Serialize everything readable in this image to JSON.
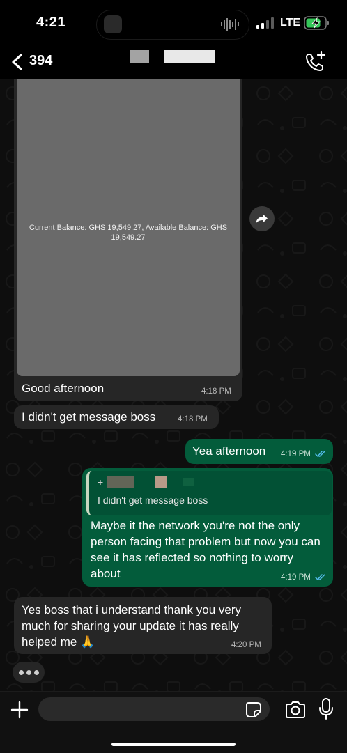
{
  "status_bar": {
    "time": "4:21",
    "network": "LTE"
  },
  "header": {
    "back_count": "394",
    "icons": {
      "back": "chevron-left-icon",
      "call": "add-call-icon"
    }
  },
  "messages": [
    {
      "direction": "incoming",
      "image_caption": "Current Balance: GHS 19,549.27, Available Balance: GHS 19,549.27",
      "text": "Good afternoon",
      "time": "4:18 PM"
    },
    {
      "direction": "incoming",
      "text": "I didn't get message boss",
      "time": "4:18 PM"
    },
    {
      "direction": "outgoing",
      "text": "Yea afternoon",
      "time": "4:19 PM"
    },
    {
      "direction": "outgoing",
      "reply_to": {
        "sender": "+",
        "text": "I didn't get message boss"
      },
      "text": "Maybe it the network you're not the only person facing that problem but now you can see it has reflected so nothing to worry about",
      "time": "4:19 PM"
    },
    {
      "direction": "incoming",
      "text": "Yes boss that i understand thank you very much for sharing your update it has really helped me 🙏",
      "time": "4:20 PM"
    }
  ],
  "composer": {
    "input_value": "",
    "icons": [
      "plus-icon",
      "sticker-icon",
      "camera-icon",
      "mic-icon"
    ]
  },
  "colors": {
    "incoming_bubble": "#262626",
    "outgoing_bubble": "#035c3b",
    "read_ticks": "#53bdeb"
  }
}
